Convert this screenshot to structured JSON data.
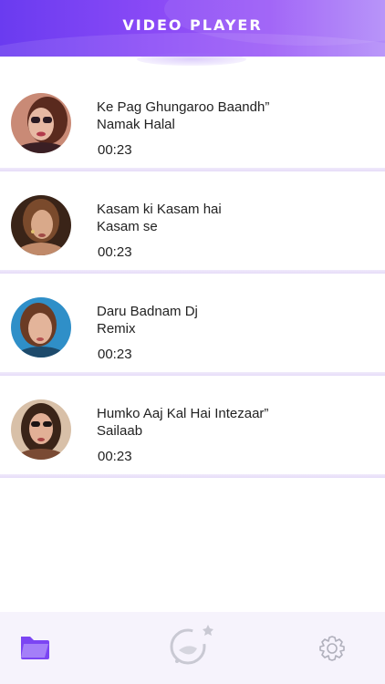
{
  "header": {
    "title": "VIDEO PLAYER"
  },
  "videos": [
    {
      "title": "Ke Pag Ghungaroo Baandh”\n Namak Halal",
      "duration": "00:23"
    },
    {
      "title": "Kasam ki Kasam hai\nKasam se",
      "duration": "00:23"
    },
    {
      "title": "Daru Badnam Dj\nRemix",
      "duration": "00:23"
    },
    {
      "title": "Humko Aaj Kal Hai Intezaar”\nSailaab",
      "duration": "00:23"
    }
  ],
  "bottom_nav": {
    "items": [
      {
        "icon": "folder-icon",
        "active": true
      },
      {
        "icon": "play-circle-icon",
        "active": false
      },
      {
        "icon": "gear-icon",
        "active": false
      }
    ]
  },
  "colors": {
    "accent": "#7b45f3",
    "header_start": "#6a3bf0",
    "header_end": "#b28cf9",
    "separator": "#e6dcf8"
  }
}
